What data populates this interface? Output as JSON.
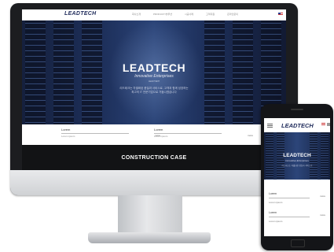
{
  "desktop": {
    "logo": "LEADTECH",
    "menu": [
      "회사소개",
      "PRODUCT/솔루션",
      "시공사례",
      "고객지원",
      "온라인문의"
    ],
    "hero": {
      "title": "LEADTECH",
      "subtitle": "Innovative Enterprises",
      "mini": "LEAD TECH",
      "desc_line1": "리드테크는 차별화된 품질과 서비스로, 고객과 함께 성장하는",
      "desc_line2": "최고의 IT 전문기업으로 거듭나겠습니다"
    },
    "boxes": [
      {
        "title": "Lorem",
        "sub": "Lorem ipsum",
        "more": "more"
      },
      {
        "title": "Lorem",
        "sub": "Lorem ipsum",
        "more": "more"
      }
    ],
    "band": "CONSTRUCTION CASE"
  },
  "phone": {
    "logo": "LEADTECH",
    "hero": {
      "title": "LEADTECH",
      "subtitle": "Innovative Enterprises",
      "desc": "리드테크는 차별화된 품질과 서비스로"
    },
    "boxes": [
      {
        "title": "Lorem",
        "sub": "Lorem ipsum",
        "more": "more"
      },
      {
        "title": "Lorem",
        "sub": "Lorem ipsum",
        "more": "more"
      }
    ]
  },
  "colors": {
    "navy": "#1e2a5a",
    "band": "#121315",
    "bezel": "#1c1d20"
  }
}
